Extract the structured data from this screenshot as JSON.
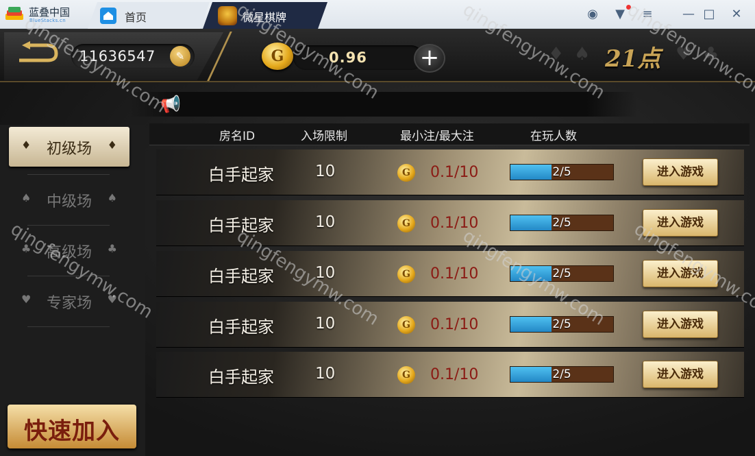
{
  "emulator": {
    "app_name": "蓝叠中国",
    "app_sub": "BlueStacks.cn",
    "tabs": [
      {
        "label": "首页",
        "icon": "home-icon"
      },
      {
        "label": "微星棋牌",
        "icon": "game-app-icon"
      }
    ],
    "window_buttons": [
      "account-icon",
      "shirt-icon",
      "menu-icon",
      "minimize-icon",
      "maximize-icon",
      "close-icon"
    ]
  },
  "topbar": {
    "player_id": "11636547",
    "coins": "0.96",
    "game_title": "21点",
    "suits": [
      "♦",
      "♠",
      "♥",
      "♣"
    ]
  },
  "sidebar": {
    "items": [
      {
        "label": "初级场",
        "suit": "♦",
        "active": true
      },
      {
        "label": "中级场",
        "suit": "♠",
        "active": false
      },
      {
        "label": "高级场",
        "suit": "♣",
        "active": false
      },
      {
        "label": "专家场",
        "suit": "♥",
        "active": false
      }
    ],
    "quick_join": "快速加入"
  },
  "table": {
    "headers": [
      "房名ID",
      "入场限制",
      "最小注/最大注",
      "在玩人数"
    ],
    "rows": [
      {
        "name": "白手起家",
        "limit": "10",
        "bet": "0.1/10",
        "players": "2/5",
        "fill": 0.4,
        "action": "进入游戏"
      },
      {
        "name": "白手起家",
        "limit": "10",
        "bet": "0.1/10",
        "players": "2/5",
        "fill": 0.4,
        "action": "进入游戏"
      },
      {
        "name": "白手起家",
        "limit": "10",
        "bet": "0.1/10",
        "players": "2/5",
        "fill": 0.4,
        "action": "进入游戏"
      },
      {
        "name": "白手起家",
        "limit": "10",
        "bet": "0.1/10",
        "players": "2/5",
        "fill": 0.4,
        "action": "进入游戏"
      },
      {
        "name": "白手起家",
        "limit": "10",
        "bet": "0.1/10",
        "players": "2/5",
        "fill": 0.4,
        "action": "进入游戏"
      }
    ]
  },
  "watermark": "qingfengymw.com",
  "colors": {
    "gold": "#c9a456",
    "bet_red": "#8b1a14",
    "bar_blue": "#2388c6"
  }
}
